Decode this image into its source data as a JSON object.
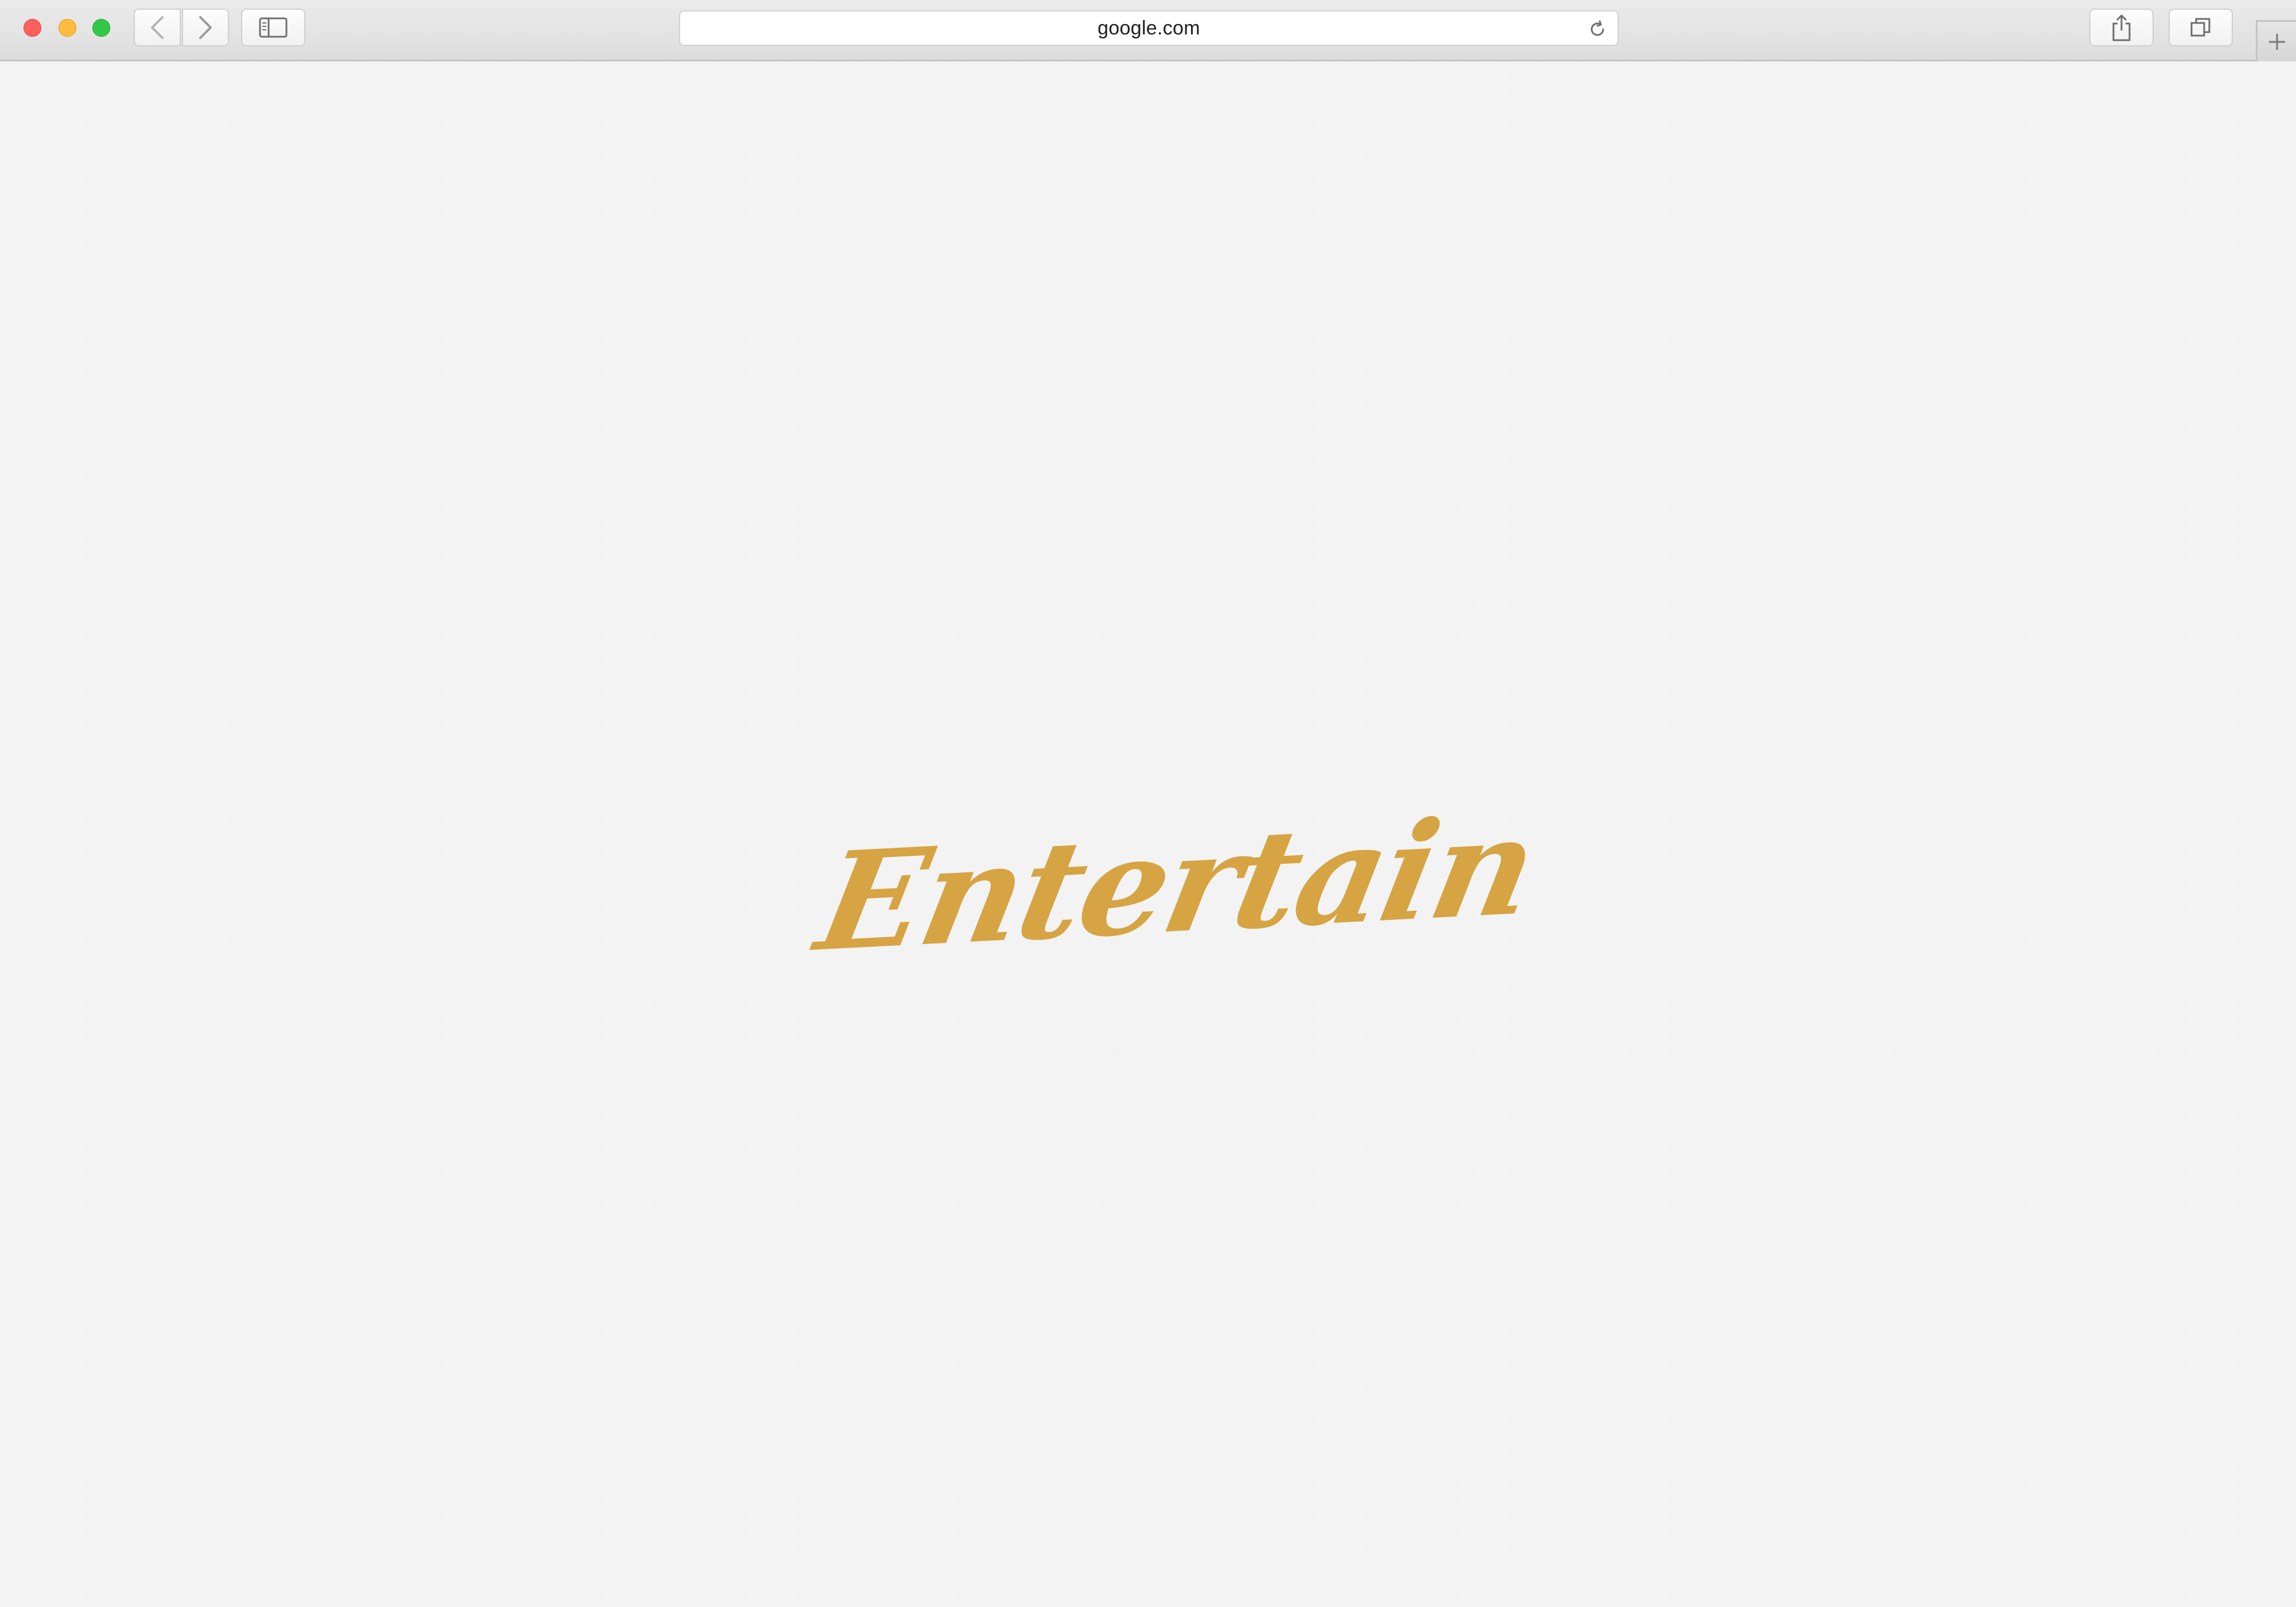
{
  "browser": {
    "address_bar": {
      "url": "google.com"
    },
    "toolbar": {
      "back_icon": "chevron-left-icon",
      "forward_icon": "chevron-right-icon",
      "sidebar_icon": "sidebar-icon",
      "share_icon": "share-icon",
      "tabs_icon": "tabs-overview-icon",
      "reload_icon": "reload-icon",
      "new_tab_icon": "plus-icon"
    }
  },
  "page": {
    "logo_text": "Entertain",
    "logo_color": "#d6a443",
    "background_color": "#f3f3f3"
  }
}
